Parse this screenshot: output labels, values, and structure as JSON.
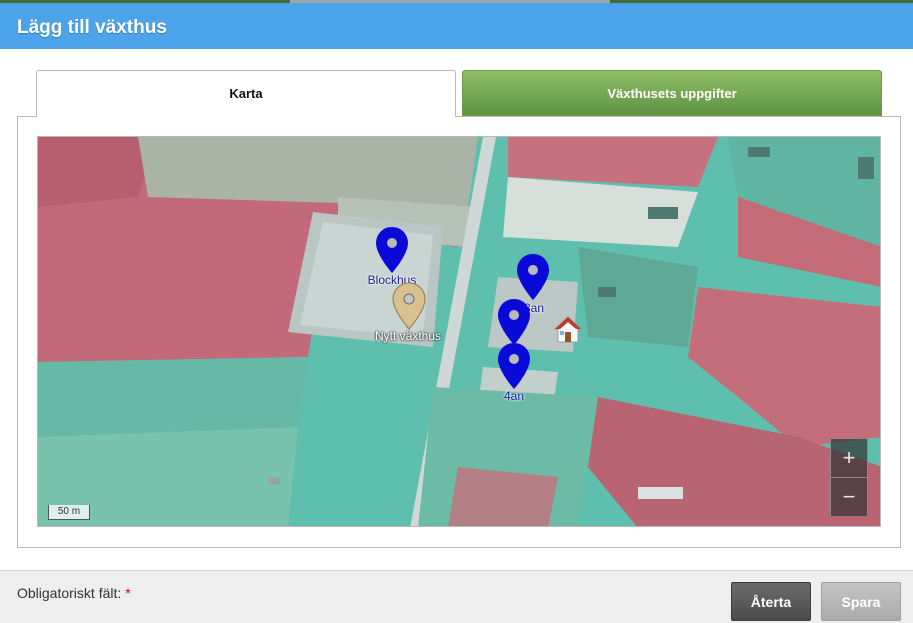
{
  "dialog": {
    "title": "Lägg till växthus"
  },
  "tabs": [
    {
      "label": "Karta",
      "active": true
    },
    {
      "label": "Växthusets uppgifter",
      "active": false
    }
  ],
  "map": {
    "markers": [
      {
        "label": "Blockhus",
        "color": "blue"
      },
      {
        "label": "Nytt växthus",
        "color": "tan"
      },
      {
        "label": "3an",
        "color": "blue"
      },
      {
        "label": "",
        "color": "blue"
      },
      {
        "label": "4an",
        "color": "blue"
      }
    ],
    "house_icon": "house-icon",
    "zoom": {
      "in_label": "+",
      "out_label": "−"
    },
    "scale_label": "50 m"
  },
  "footer": {
    "required_text": "Obligatoriskt fält:",
    "required_marker": "*",
    "cancel_label": "Återta",
    "save_label": "Spara"
  },
  "colors": {
    "header": "#4da3ea",
    "tab_inactive": "#6ea350",
    "marker_blue": "#0a0ad8",
    "marker_tan": "#d8c08f",
    "cancel_button": "#555555",
    "save_button": "#b5b5b5"
  }
}
